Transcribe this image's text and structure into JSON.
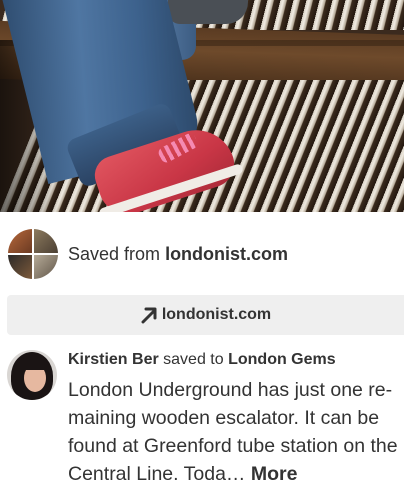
{
  "saved_from": {
    "prefix": "Saved from",
    "domain": "londonist.com"
  },
  "visit_button": {
    "label": "londonist.com",
    "icon": "arrow-up-right-icon"
  },
  "pinner": {
    "name": "Kirstien Ber",
    "action": "saved to",
    "board": "London Gems"
  },
  "description": {
    "text": "London Underground has just one re-maining wooden escalator. It can be found at Greenford tube station on the Central Line. Toda…",
    "more_label": "More"
  },
  "colors": {
    "text": "#333333",
    "button_bg": "#efefef",
    "shoe": "#c93646"
  }
}
